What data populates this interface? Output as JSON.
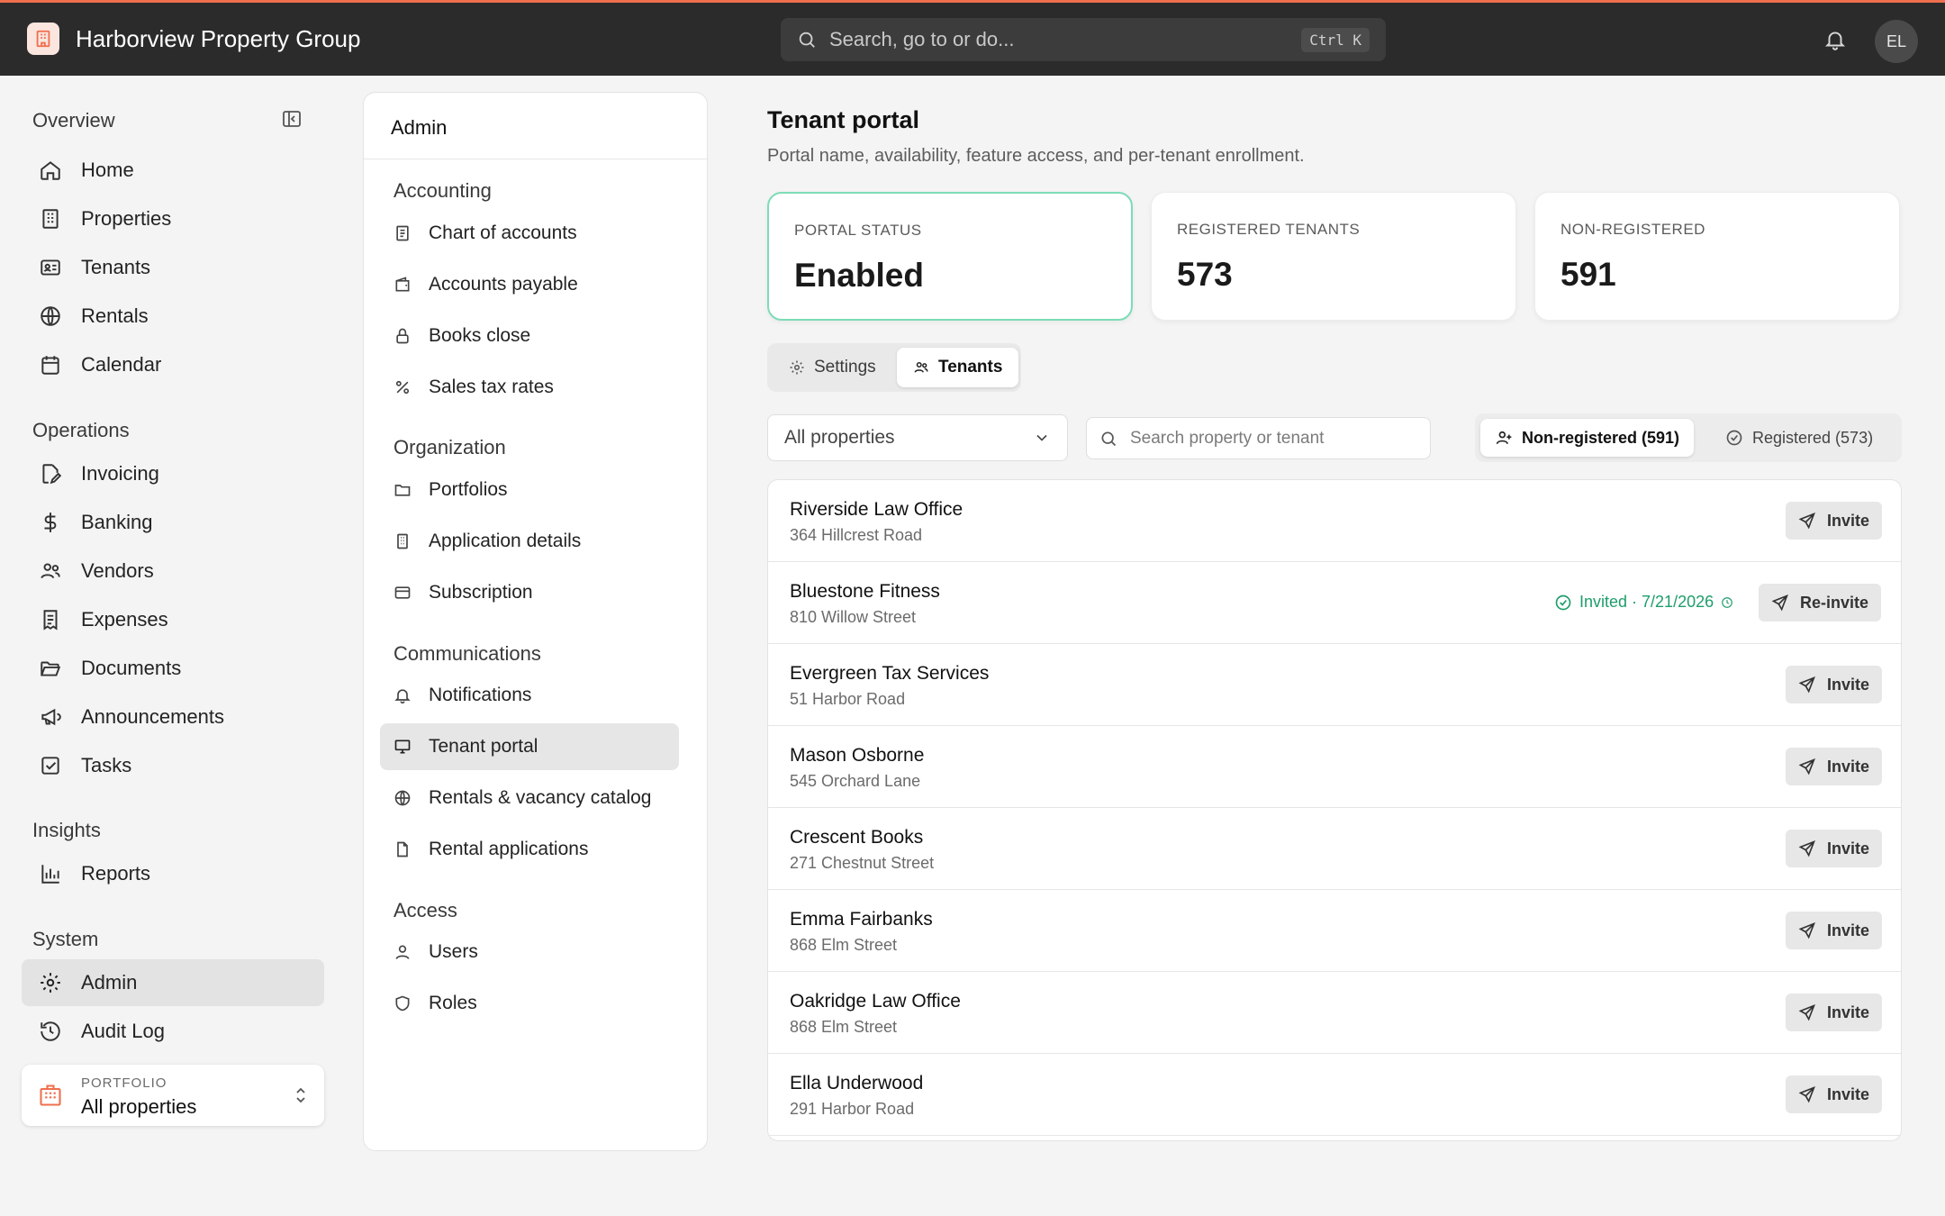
{
  "app": {
    "company_name": "Harborview Property Group"
  },
  "header": {
    "search_placeholder": "Search, go to or do...",
    "search_shortcut": "Ctrl K",
    "avatar_initials": "EL"
  },
  "sidebar": {
    "sections": [
      {
        "title": "Overview",
        "items": [
          {
            "label": "Home",
            "icon": "home-icon"
          },
          {
            "label": "Properties",
            "icon": "building-icon"
          },
          {
            "label": "Tenants",
            "icon": "id-card-icon"
          },
          {
            "label": "Rentals",
            "icon": "globe-icon"
          },
          {
            "label": "Calendar",
            "icon": "calendar-icon"
          }
        ]
      },
      {
        "title": "Operations",
        "items": [
          {
            "label": "Invoicing",
            "icon": "invoice-edit-icon"
          },
          {
            "label": "Banking",
            "icon": "dollar-icon"
          },
          {
            "label": "Vendors",
            "icon": "users-icon"
          },
          {
            "label": "Expenses",
            "icon": "receipt-icon"
          },
          {
            "label": "Documents",
            "icon": "folder-open-icon"
          },
          {
            "label": "Announcements",
            "icon": "megaphone-icon"
          },
          {
            "label": "Tasks",
            "icon": "checkbox-icon"
          }
        ]
      },
      {
        "title": "Insights",
        "items": [
          {
            "label": "Reports",
            "icon": "bar-chart-icon"
          }
        ]
      },
      {
        "title": "System",
        "items": [
          {
            "label": "Admin",
            "icon": "gear-icon",
            "active": true
          },
          {
            "label": "Audit Log",
            "icon": "history-icon"
          }
        ]
      }
    ],
    "portfolio": {
      "kicker": "PORTFOLIO",
      "value": "All properties"
    }
  },
  "admin_panel": {
    "title": "Admin",
    "groups": [
      {
        "title": "Accounting",
        "items": [
          {
            "label": "Chart of accounts",
            "icon": "ledger-icon"
          },
          {
            "label": "Accounts payable",
            "icon": "wallet-icon"
          },
          {
            "label": "Books close",
            "icon": "lock-icon"
          },
          {
            "label": "Sales tax rates",
            "icon": "percent-icon"
          }
        ]
      },
      {
        "title": "Organization",
        "items": [
          {
            "label": "Portfolios",
            "icon": "folder-icon"
          },
          {
            "label": "Application details",
            "icon": "building-icon"
          },
          {
            "label": "Subscription",
            "icon": "credit-card-icon"
          }
        ]
      },
      {
        "title": "Communications",
        "items": [
          {
            "label": "Notifications",
            "icon": "bell-icon"
          },
          {
            "label": "Tenant portal",
            "icon": "monitor-icon",
            "active": true
          },
          {
            "label": "Rentals & vacancy catalog",
            "icon": "globe-icon"
          },
          {
            "label": "Rental applications",
            "icon": "file-icon"
          }
        ]
      },
      {
        "title": "Access",
        "items": [
          {
            "label": "Users",
            "icon": "user-icon"
          },
          {
            "label": "Roles",
            "icon": "shield-icon"
          }
        ]
      }
    ]
  },
  "main": {
    "title": "Tenant portal",
    "subtitle": "Portal name, availability, feature access, and per-tenant enrollment.",
    "stats": [
      {
        "label": "PORTAL STATUS",
        "value": "Enabled"
      },
      {
        "label": "REGISTERED TENANTS",
        "value": "573"
      },
      {
        "label": "NON-REGISTERED",
        "value": "591"
      }
    ],
    "tabs": [
      {
        "label": "Settings"
      },
      {
        "label": "Tenants"
      }
    ],
    "active_tab": "Tenants",
    "filters": {
      "property_select": "All properties",
      "search_placeholder": "Search property or tenant",
      "segments": [
        {
          "label": "Non-registered (591)"
        },
        {
          "label": "Registered (573)"
        }
      ]
    },
    "tenants": [
      {
        "name": "Riverside Law Office",
        "address": "364 Hillcrest Road",
        "action": "Invite"
      },
      {
        "name": "Bluestone Fitness",
        "address": "810 Willow Street",
        "action": "Re-invite",
        "status": "Invited · 7/21/2026"
      },
      {
        "name": "Evergreen Tax Services",
        "address": "51 Harbor Road",
        "action": "Invite"
      },
      {
        "name": "Mason Osborne",
        "address": "545 Orchard Lane",
        "action": "Invite"
      },
      {
        "name": "Crescent Books",
        "address": "271 Chestnut Street",
        "action": "Invite"
      },
      {
        "name": "Emma Fairbanks",
        "address": "868 Elm Street",
        "action": "Invite"
      },
      {
        "name": "Oakridge Law Office",
        "address": "868 Elm Street",
        "action": "Invite"
      },
      {
        "name": "Ella Underwood",
        "address": "291 Harbor Road",
        "action": "Invite"
      }
    ]
  },
  "colors": {
    "accent": "#ef6f4e",
    "success": "#1f9d6b",
    "highlight_border": "#7ddcb7",
    "topbar": "#2b2b2b"
  }
}
